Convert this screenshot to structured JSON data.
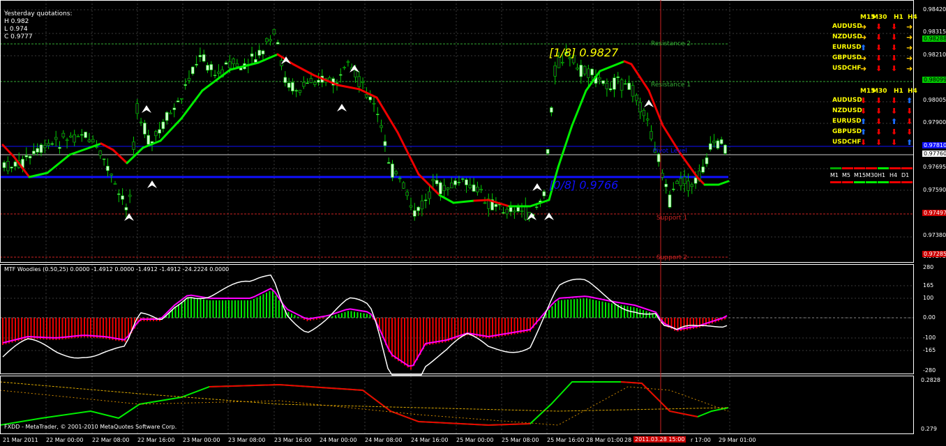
{
  "colors": {
    "background": "#000000",
    "grid": "#3a3a3a",
    "bull_candle": "#ccffcc",
    "bear_candle": "#111111",
    "candle_outline": "#00cc00",
    "ma_up": "#00ee00",
    "ma_down": "#ee0000",
    "pivot_line": "#1010ff",
    "resistance": "#33aa33",
    "support": "#cc2222",
    "murrey_text_yellow": "#ffff00",
    "murrey_text_blue": "#1010ff",
    "woodies_cci": "#ff00ff",
    "woodies_turbo": "#ffffff",
    "hist_up": "#00ee00",
    "hist_down": "#ee0000",
    "price_tag_green": "#00cc00",
    "price_tag_red": "#cc0000",
    "current_price_tag": "#ffffff"
  },
  "quotes_box": {
    "title": "Yesterday quotations:",
    "high": "H 0.982",
    "low": "L 0.974",
    "close": "C 0.9777"
  },
  "price_axis": {
    "labels": [
      "0.98420",
      "0.98315",
      "0.98210",
      "0.98005",
      "0.97900",
      "0.97695",
      "0.97590",
      "0.97380",
      "0.97275"
    ],
    "tag_resistance2": "0.98288",
    "tag_resistance1": "0.98099",
    "tag_pivot": "0.97810",
    "tag_current": "0.97760",
    "tag_support1": "0.97497",
    "tag_support2": "0.97285"
  },
  "levels": {
    "resistance2": "Resistance 2",
    "resistance1": "Resistance 1",
    "pivot": "Pivot Level",
    "support1": "Support 1",
    "support2": "Support 2"
  },
  "murrey": {
    "upper": "[1/8]  0.9827",
    "lower": "[0/8]  0.9766"
  },
  "signal_table_1": {
    "headers": [
      "M15",
      "M30",
      "H1",
      "H4"
    ],
    "rows": [
      {
        "pair": "AUDUSD",
        "signals": [
          "right-yellow",
          "down-red",
          "down-red",
          "right-yellow"
        ]
      },
      {
        "pair": "NZDUSD",
        "signals": [
          "right-yellow",
          "down-red",
          "down-red",
          "right-yellow"
        ]
      },
      {
        "pair": "EURUSD",
        "signals": [
          "up-blue",
          "down-red",
          "down-red",
          "right-yellow"
        ]
      },
      {
        "pair": "GBPUSD",
        "signals": [
          "right-yellow",
          "down-red",
          "down-red",
          "right-yellow"
        ]
      },
      {
        "pair": "USDCHF",
        "signals": [
          "right-yellow",
          "down-red",
          "down-red",
          "right-yellow"
        ]
      }
    ]
  },
  "signal_table_2": {
    "headers": [
      "M15",
      "M30",
      "H1",
      "H4"
    ],
    "rows": [
      {
        "pair": "AUDUSD",
        "signals": [
          "down-red",
          "down-red",
          "down-red",
          "up-blue"
        ]
      },
      {
        "pair": "NZDUSD",
        "signals": [
          "down-red",
          "down-red",
          "down-red",
          "down-red"
        ]
      },
      {
        "pair": "EURUSD",
        "signals": [
          "up-blue",
          "down-red",
          "up-blue",
          "down-red"
        ]
      },
      {
        "pair": "GBPUSD",
        "signals": [
          "up-blue",
          "down-red",
          "down-red",
          "down-red"
        ]
      },
      {
        "pair": "USDCHF",
        "signals": [
          "down-red",
          "down-red",
          "down-red",
          "up-blue"
        ]
      }
    ]
  },
  "tf_strip": {
    "labels": [
      "M1",
      "M5",
      "M15",
      "M30",
      "H1",
      "H4",
      "D1"
    ],
    "top": [
      "#00aa00",
      "#ee0000",
      "#ee0000",
      "#ee0000",
      "#00ee00",
      "#ee0000",
      "#ee0000"
    ],
    "bottom": [
      "#ee0000",
      "#ee0000",
      "#00ee00",
      "#00ee00",
      "#00ee00",
      "#ee0000",
      "#ee0000"
    ]
  },
  "woodies": {
    "title": "MTF Woodies (0.50,25) 0.0000 -1.4912 0.0000 -1.4912 -1.4912 -24.2224 0.0000",
    "axis_labels": [
      "280",
      "165",
      "100",
      "0.00",
      "-100",
      "-165",
      "-280"
    ]
  },
  "lower_panel": {
    "axis_top": "0.2828",
    "axis_bottom": "0.279",
    "credit": "FXDD - MetaTrader, © 2001-2010 MetaQuotes Software Corp."
  },
  "time_axis": {
    "labels": [
      "21 Mar 2011",
      "22 Mar 00:00",
      "22 Mar 08:00",
      "22 Mar 16:00",
      "23 Mar 00:00",
      "23 Mar 08:00",
      "23 Mar 16:00",
      "24 Mar 00:00",
      "24 Mar 08:00",
      "24 Mar 16:00",
      "25 Mar 00:00",
      "25 Mar 08:00",
      "25 Mar 16:00",
      "28 Mar 01:00",
      "28",
      "r 17:00",
      "29 Mar 01:00"
    ],
    "highlight": "2011.03.28 15:00"
  }
}
